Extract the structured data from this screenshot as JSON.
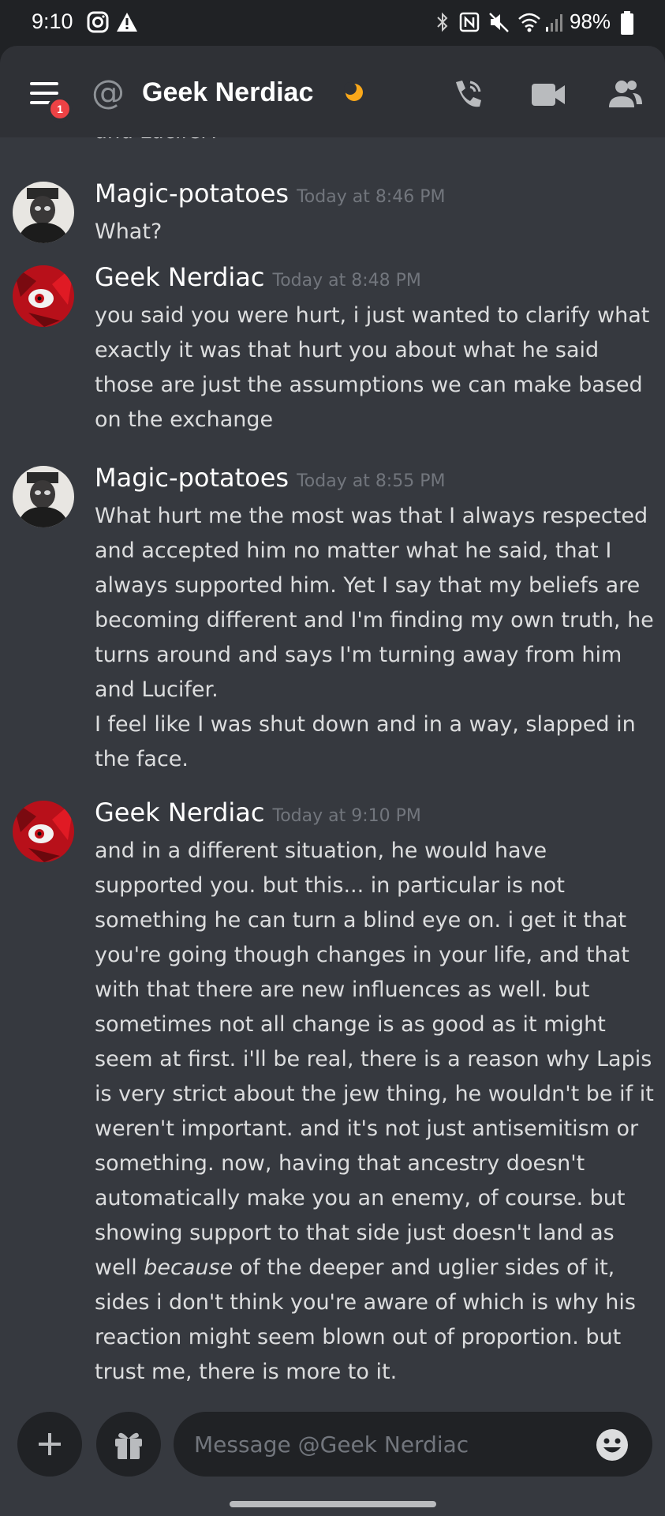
{
  "status_bar": {
    "time": "9:10",
    "battery": "98%"
  },
  "header": {
    "unread_count": "1",
    "channel_prefix": "@",
    "title": "Geek Nerdiac"
  },
  "messages": [
    {
      "author": "Magic-potatoes",
      "timestamp": "Today at 8:46 PM",
      "text": "What?"
    },
    {
      "author": "Geek Nerdiac",
      "timestamp": "Today at 8:48 PM",
      "text": "you said you were hurt, i just wanted to clarify what exactly it was that hurt you about what he said\nthose are just the assumptions we can make based on the exchange"
    },
    {
      "author": "Magic-potatoes",
      "timestamp": "Today at 8:55 PM",
      "text": "What hurt me the most was that I always respected and accepted him no matter what he said, that I always supported him. Yet I say that my beliefs are becoming different and I'm finding my own truth, he turns around and says I'm turning away from him and Lucifer.\nI feel like I was shut down and in a way, slapped in the face."
    },
    {
      "author": "Geek Nerdiac",
      "timestamp": "Today at 9:10 PM",
      "text_before": "and in a different situation, he would have supported you. but this... in particular is not something he can turn a blind eye on. i get it that you're going though changes in your life, and that with that there are new influences as well. but sometimes not all change is as good as it might seem at first. i'll be real, there is a reason why Lapis is very strict about the jew thing, he wouldn't be if it weren't important. and it's not just antisemitism or something. now, having that ancestry doesn't automatically make you an enemy, of course. but showing support to that side just doesn't land as well ",
      "text_emphasis": "because",
      "text_after": " of the deeper and uglier sides of it, sides i don't think you're aware of which is why his reaction might seem blown out of proportion. but trust me, there is more to it."
    }
  ],
  "previous_message_tail": "and Lucifer?",
  "composer": {
    "placeholder": "Message @Geek Nerdiac"
  }
}
